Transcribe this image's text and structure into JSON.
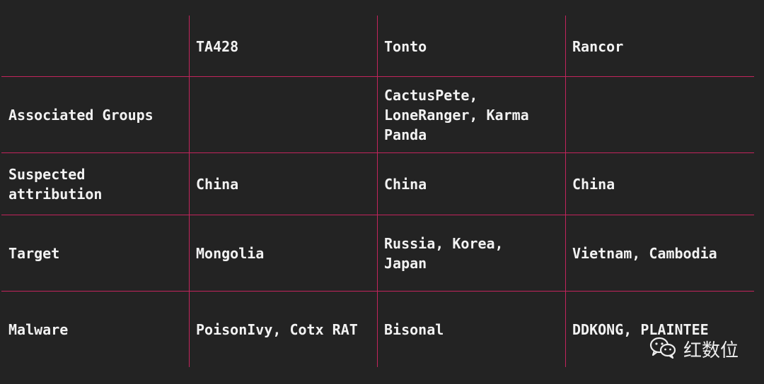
{
  "table": {
    "headers": [
      "",
      "TA428",
      "Tonto",
      "Rancor"
    ],
    "rows": [
      {
        "label": "Associated Groups",
        "ta428": "",
        "tonto": "CactusPete,\nLoneRanger, Karma\nPanda",
        "rancor": ""
      },
      {
        "label": "Suspected\nattribution",
        "ta428": "China",
        "tonto": "China",
        "rancor": "China"
      },
      {
        "label": "Target",
        "ta428": "Mongolia",
        "tonto": "Russia, Korea,\nJapan",
        "rancor": "Vietnam, Cambodia"
      },
      {
        "label": "Malware",
        "ta428": "PoisonIvy, Cotx RAT",
        "tonto": "Bisonal",
        "rancor": "DDKONG, PLAINTEE"
      }
    ]
  },
  "watermark": {
    "icon": "wechat-icon",
    "text": "红数位"
  },
  "colors": {
    "background": "#232323",
    "grid_lines": "#c2245c",
    "text": "#f2f2f2"
  }
}
